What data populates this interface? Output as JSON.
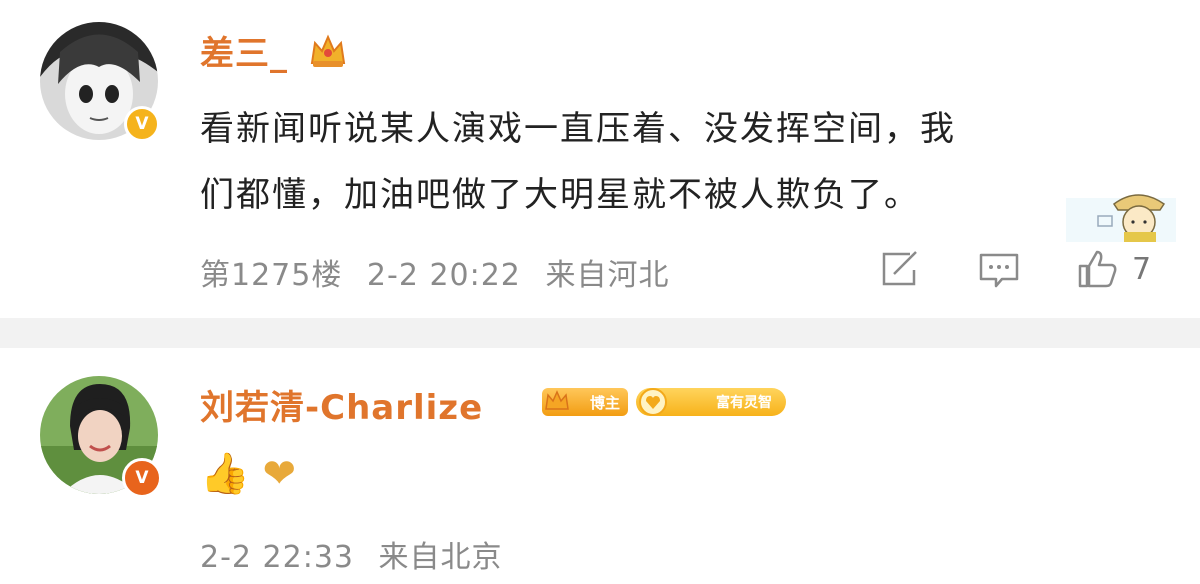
{
  "comments": [
    {
      "username": "差三_",
      "crown_icon": "crown-icon",
      "text_line1": "看新闻听说某人演戏一直压着、没发挥空间，我",
      "text_line2": "们都懂，加油吧做了大明星就不被人欺负了。",
      "verified": "V",
      "floor": "第1275楼",
      "time": "2-2 20:22",
      "location": "来自河北",
      "likes": "7"
    },
    {
      "username": "刘若清-Charlize",
      "verified": "V",
      "badge_bozhu": "博主",
      "badge_fan": "富有灵智",
      "emoji": "👍 ❤",
      "time": "2-2 22:33",
      "location": "来自北京"
    }
  ],
  "colors": {
    "username": "#e0752c",
    "meta": "#8a8a8a",
    "divider": "#f2f2f2"
  }
}
